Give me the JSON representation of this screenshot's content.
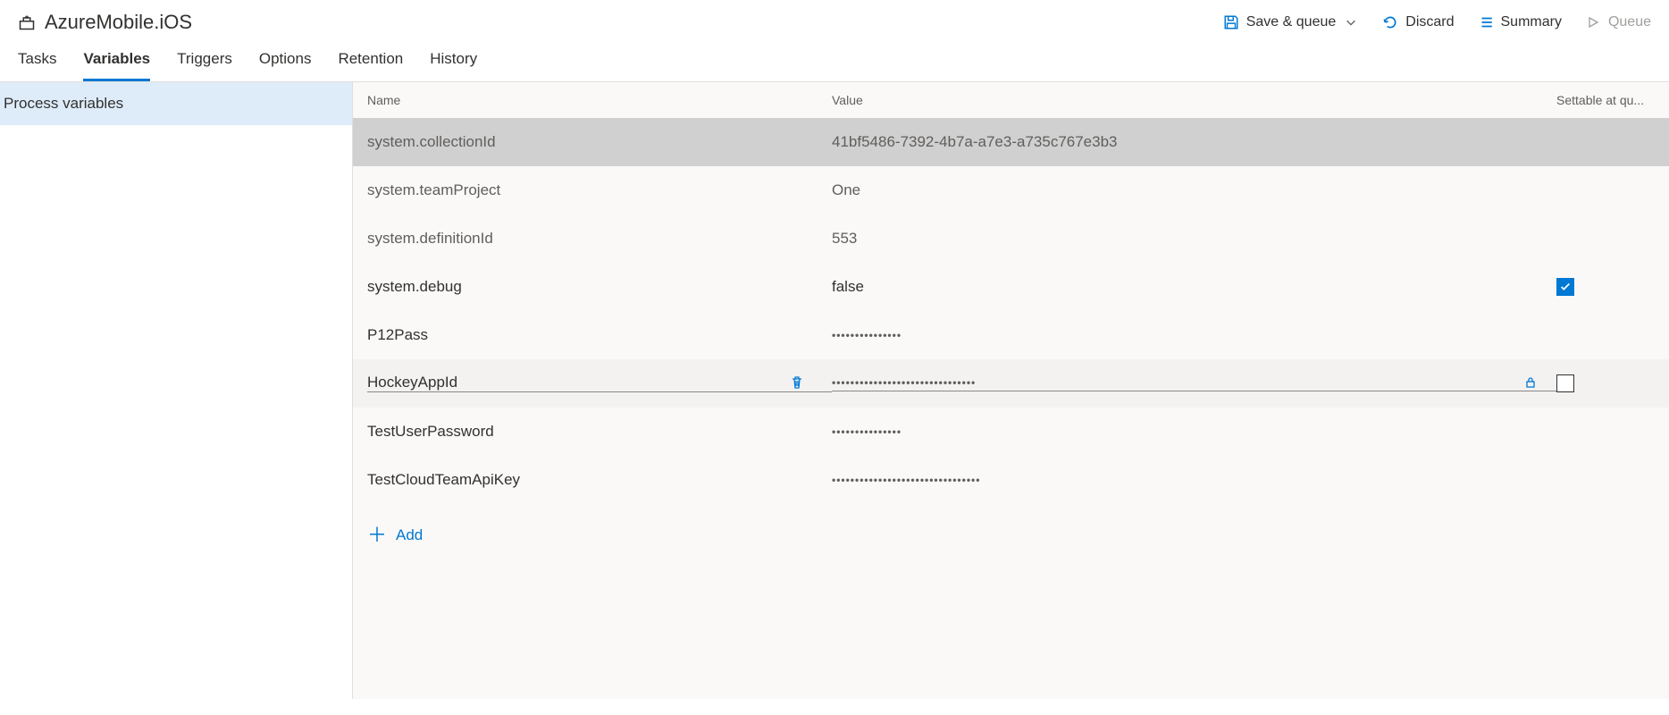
{
  "header": {
    "title": "AzureMobile.iOS",
    "actions": {
      "save_queue": "Save & queue",
      "discard": "Discard",
      "summary": "Summary",
      "queue": "Queue"
    }
  },
  "tabs": [
    "Tasks",
    "Variables",
    "Triggers",
    "Options",
    "Retention",
    "History"
  ],
  "active_tab": "Variables",
  "sidebar": {
    "items": [
      "Process variables"
    ],
    "selected": "Process variables"
  },
  "grid": {
    "columns": {
      "name": "Name",
      "value": "Value",
      "settable": "Settable at qu..."
    },
    "rows": [
      {
        "name": "system.collectionId",
        "value": "41bf5486-7392-4b7a-a7e3-a735c767e3b3",
        "masked": false,
        "settable": null,
        "state": "selected",
        "dim": true
      },
      {
        "name": "system.teamProject",
        "value": "One",
        "masked": false,
        "settable": null,
        "state": "normal",
        "dim": true
      },
      {
        "name": "system.definitionId",
        "value": "553",
        "masked": false,
        "settable": null,
        "state": "normal",
        "dim": true
      },
      {
        "name": "system.debug",
        "value": "false",
        "masked": false,
        "settable": true,
        "state": "normal",
        "dim": false
      },
      {
        "name": "P12Pass",
        "value": "•••••••••••••••",
        "masked": true,
        "settable": null,
        "state": "normal",
        "dim": false
      },
      {
        "name": "HockeyAppId",
        "value": "•••••••••••••••••••••••••••••••",
        "masked": true,
        "settable": false,
        "state": "editing",
        "dim": false,
        "showDelete": true,
        "showLock": true
      },
      {
        "name": "TestUserPassword",
        "value": "•••••••••••••••",
        "masked": true,
        "settable": null,
        "state": "normal",
        "dim": false
      },
      {
        "name": "TestCloudTeamApiKey",
        "value": "••••••••••••••••••••••••••••••••",
        "masked": true,
        "settable": null,
        "state": "normal",
        "dim": false
      }
    ],
    "add_label": "Add"
  }
}
